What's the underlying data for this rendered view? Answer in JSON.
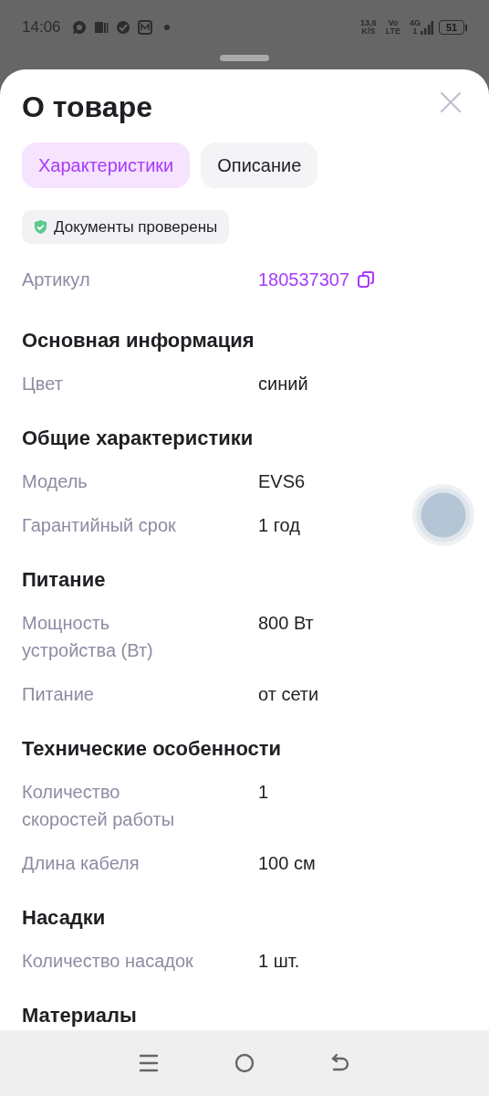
{
  "status_bar": {
    "time": "14:06",
    "speed": "13,6",
    "speed_unit": "K/S",
    "volte_top": "Vo",
    "volte_bottom": "LTE",
    "network": "4G",
    "sim": "1",
    "battery": "51"
  },
  "sheet": {
    "title": "О товаре",
    "tabs": [
      {
        "label": "Характеристики",
        "selected": true
      },
      {
        "label": "Описание",
        "selected": false
      }
    ],
    "badge": "Документы проверены",
    "article": {
      "label": "Артикул",
      "value": "180537307"
    },
    "sections": [
      {
        "title": "Основная информация",
        "rows": [
          {
            "label": "Цвет",
            "value": "синий"
          }
        ]
      },
      {
        "title": "Общие характеристики",
        "rows": [
          {
            "label": "Модель",
            "value": "EVS6"
          },
          {
            "label": "Гарантийный срок",
            "value": "1 год"
          }
        ]
      },
      {
        "title": "Питание",
        "rows": [
          {
            "label": "Мощность устройства (Вт)",
            "value": "800 Вт"
          },
          {
            "label": "Питание",
            "value": "от сети"
          }
        ]
      },
      {
        "title": "Технические особенности",
        "rows": [
          {
            "label": "Количество скоростей работы",
            "value": "1"
          },
          {
            "label": "Длина кабеля",
            "value": "100 см"
          }
        ]
      },
      {
        "title": "Насадки",
        "rows": [
          {
            "label": "Количество насадок",
            "value": "1 шт."
          }
        ]
      },
      {
        "title": "Материалы"
      }
    ]
  }
}
